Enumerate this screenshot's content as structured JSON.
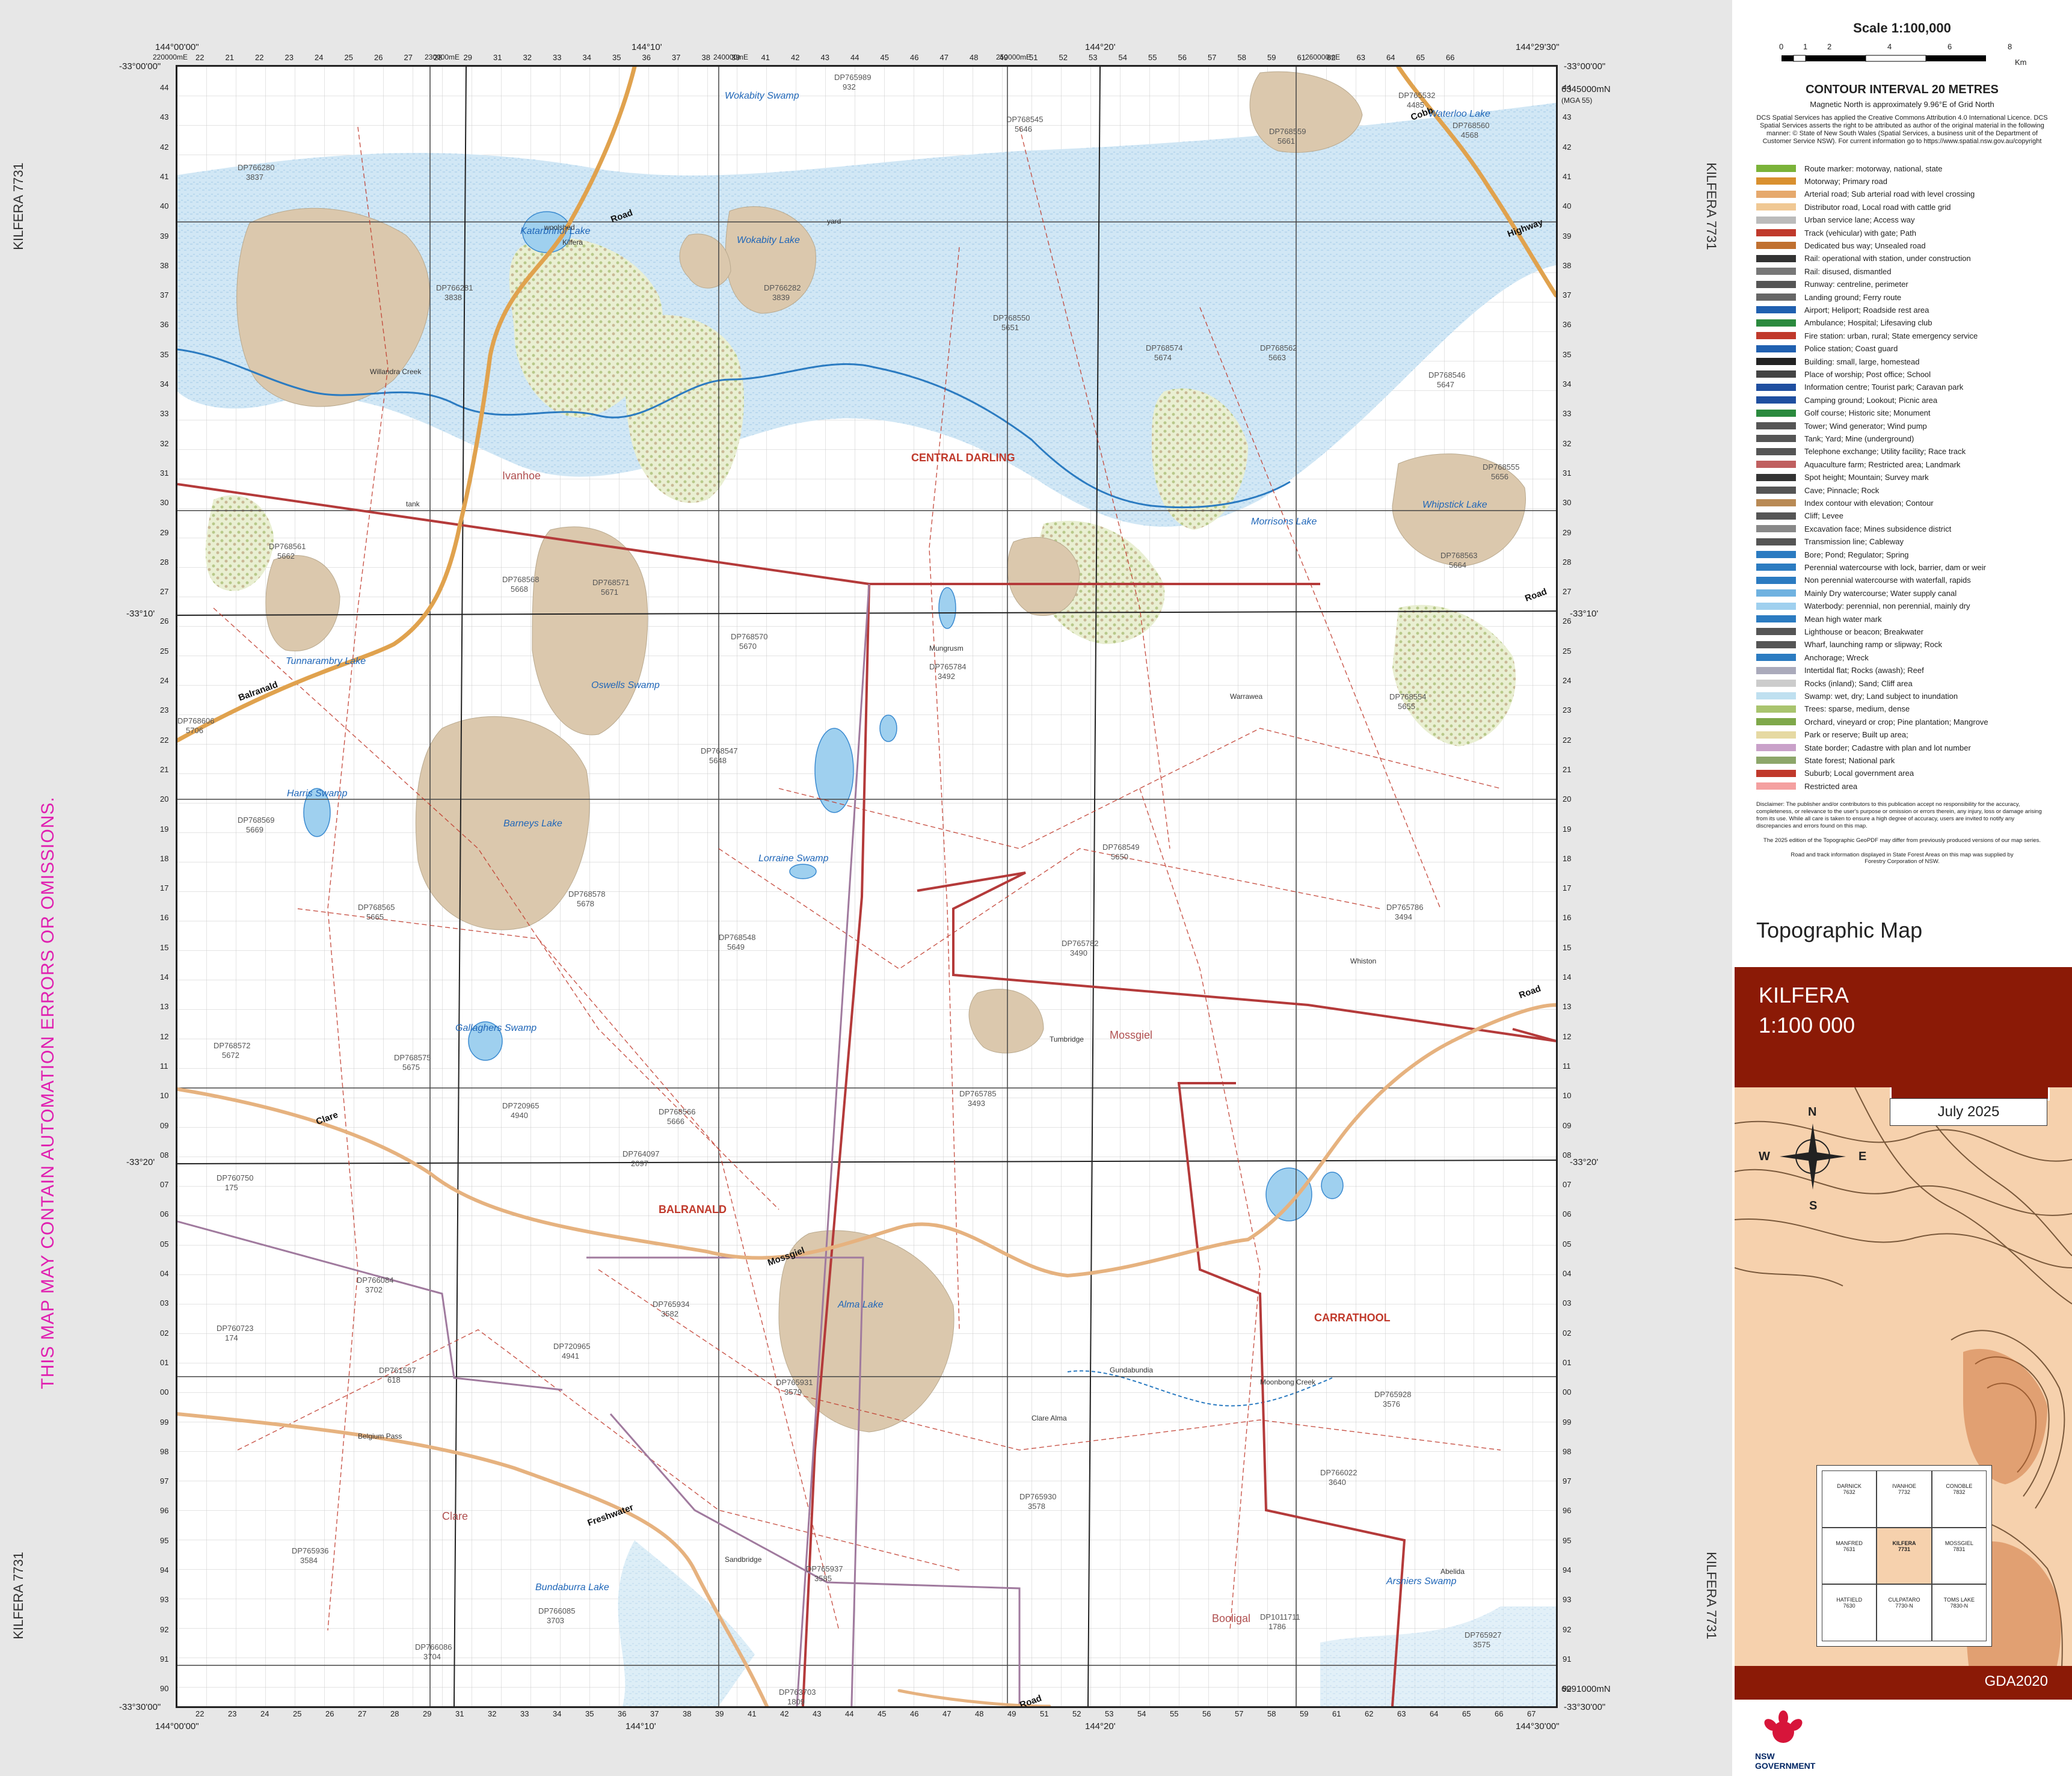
{
  "side_labels": {
    "left_top": "KILFERA 7731",
    "left_bottom": "KILFERA 7731",
    "right_top": "KILFERA 7731",
    "right_bottom": "KILFERA 7731"
  },
  "warning": "THIS MAP MAY CONTAIN AUTOMATION ERRORS OR OMISSIONS.",
  "coords": {
    "top_left_lon": "144°00'00\"",
    "top_left_lat": "-33°00'00\"",
    "top_mid1": "144°10'",
    "top_mid2": "144°20'",
    "top_right_lon": "144°29'30\"",
    "top_right_lat": "-33°00'00\"",
    "left_mid1": "-33°10'",
    "left_mid2": "-33°20'",
    "right_mid1": "-33°10'",
    "right_mid2": "-33°20'",
    "bottom_left_lon": "144°00'00\"",
    "bottom_left_lat": "-33°30'00\"",
    "bottom_mid1": "144°10'",
    "bottom_mid2": "144°20'",
    "bottom_right_lon": "144°30'00\"",
    "bottom_right_lat": "-33°30'00\"",
    "e_top": "220000mE",
    "e_top2": "230000mE",
    "e_top3": "240000mE",
    "e_top4": "250000mE",
    "e_top5": "260000mE",
    "n_top": "6345000mN",
    "n_mga": "(MGA 55)",
    "n_bottom": "6291000mN"
  },
  "grid": {
    "eastings_top": [
      "22",
      "21",
      "22",
      "23",
      "24",
      "25",
      "26",
      "27",
      "28",
      "29",
      "31",
      "32",
      "33",
      "34",
      "35",
      "36",
      "37",
      "38",
      "39",
      "41",
      "42",
      "43",
      "44",
      "45",
      "46",
      "47",
      "48",
      "49",
      "51",
      "52",
      "53",
      "54",
      "55",
      "56",
      "57",
      "58",
      "59",
      "61",
      "62",
      "63",
      "64",
      "65",
      "66"
    ],
    "eastings_bottom": [
      "22",
      "23",
      "24",
      "25",
      "26",
      "27",
      "28",
      "29",
      "31",
      "32",
      "33",
      "34",
      "35",
      "36",
      "37",
      "38",
      "39",
      "41",
      "42",
      "43",
      "44",
      "45",
      "46",
      "47",
      "48",
      "49",
      "51",
      "52",
      "53",
      "54",
      "55",
      "56",
      "57",
      "58",
      "59",
      "61",
      "62",
      "63",
      "64",
      "65",
      "66",
      "67"
    ],
    "northings": [
      "44",
      "43",
      "42",
      "41",
      "40",
      "39",
      "38",
      "37",
      "36",
      "35",
      "34",
      "33",
      "32",
      "31",
      "30",
      "29",
      "28",
      "27",
      "26",
      "25",
      "24",
      "23",
      "22",
      "21",
      "20",
      "19",
      "18",
      "17",
      "16",
      "15",
      "14",
      "13",
      "12",
      "11",
      "10",
      "09",
      "08",
      "07",
      "06",
      "05",
      "04",
      "03",
      "02",
      "01",
      "00",
      "99",
      "98",
      "97",
      "96",
      "95",
      "94",
      "93",
      "92",
      "91",
      "90"
    ]
  },
  "map_labels": {
    "lakes": [
      {
        "name": "Wokabity Swamp"
      },
      {
        "name": "Waterloo Lake"
      },
      {
        "name": "Katarbrinol Lake"
      },
      {
        "name": "Wokabity Lake"
      },
      {
        "name": "Whipstick Lake"
      },
      {
        "name": "Morrisons Lake"
      },
      {
        "name": "Tunnarambry Lake"
      },
      {
        "name": "Oswells Swamp"
      },
      {
        "name": "Harris Swamp"
      },
      {
        "name": "Barneys Lake"
      },
      {
        "name": "Lorraine Swamp"
      },
      {
        "name": "Gallaghers Swamp"
      },
      {
        "name": "Alma Lake"
      },
      {
        "name": "Bundaburra Lake"
      },
      {
        "name": "Arsniers Swamp"
      }
    ],
    "regions": [
      {
        "name": "CENTRAL DARLING"
      },
      {
        "name": "BALRANALD"
      },
      {
        "name": "CARRATHOOL"
      },
      {
        "name": "Mossgiel"
      },
      {
        "name": "Clare"
      },
      {
        "name": "Booligal"
      },
      {
        "name": "Ivanhoe"
      }
    ],
    "roads": [
      {
        "name": "Balranald"
      },
      {
        "name": "Road"
      },
      {
        "name": "Clare"
      },
      {
        "name": "Mossgiel"
      },
      {
        "name": "Cobb"
      },
      {
        "name": "Highway"
      },
      {
        "name": "Freshwater"
      },
      {
        "name": "Road"
      },
      {
        "name": "Road"
      },
      {
        "name": "Road"
      }
    ],
    "lots": [
      {
        "lot": "DP766280",
        "num": "3837"
      },
      {
        "lot": "DP765989",
        "num": "932"
      },
      {
        "lot": "DP768545",
        "num": "5646"
      },
      {
        "lot": "DP768559",
        "num": "5661"
      },
      {
        "lot": "DP766281",
        "num": "3838"
      },
      {
        "lot": "DP766282",
        "num": "3839"
      },
      {
        "lot": "DP768550",
        "num": "5651"
      },
      {
        "lot": "DP768574",
        "num": "5674"
      },
      {
        "lot": "DP768562",
        "num": "5663"
      },
      {
        "lot": "DP768546",
        "num": "5647"
      },
      {
        "lot": "DP768561",
        "num": "5662"
      },
      {
        "lot": "DP768568",
        "num": "5668"
      },
      {
        "lot": "DP768571",
        "num": "5671"
      },
      {
        "lot": "DP768570",
        "num": "5670"
      },
      {
        "lot": "DP765784",
        "num": "3492"
      },
      {
        "lot": "DP768563",
        "num": "5664"
      },
      {
        "lot": "DP768547",
        "num": "5648"
      },
      {
        "lot": "DP768569",
        "num": "5669"
      },
      {
        "lot": "DP768549",
        "num": "5650"
      },
      {
        "lot": "DP768578",
        "num": "5678"
      },
      {
        "lot": "DP768565",
        "num": "5665"
      },
      {
        "lot": "DP768548",
        "num": "5649"
      },
      {
        "lot": "DP765782",
        "num": "3490"
      },
      {
        "lot": "DP765786",
        "num": "3494"
      },
      {
        "lot": "DP768572",
        "num": "5672"
      },
      {
        "lot": "DP768575",
        "num": "5675"
      },
      {
        "lot": "DP720965",
        "num": "4940"
      },
      {
        "lot": "DP765785",
        "num": "3493"
      },
      {
        "lot": "DP768566",
        "num": "5666"
      },
      {
        "lot": "DP760750",
        "num": "175"
      },
      {
        "lot": "DP764097",
        "num": "2097"
      },
      {
        "lot": "DP766084",
        "num": "3702"
      },
      {
        "lot": "DP765934",
        "num": "3582"
      },
      {
        "lot": "DP760723",
        "num": "174"
      },
      {
        "lot": "DP720965",
        "num": "4941"
      },
      {
        "lot": "DP761587",
        "num": "618"
      },
      {
        "lot": "DP765931",
        "num": "3579"
      },
      {
        "lot": "DP765928",
        "num": "3576"
      },
      {
        "lot": "DP766022",
        "num": "3640"
      },
      {
        "lot": "DP765930",
        "num": "3578"
      },
      {
        "lot": "DP765936",
        "num": "3584"
      },
      {
        "lot": "DP765937",
        "num": "3585"
      },
      {
        "lot": "DP766085",
        "num": "3703"
      },
      {
        "lot": "DP766086",
        "num": "3704"
      },
      {
        "lot": "DP1011711",
        "num": "1786"
      },
      {
        "lot": "DP765927",
        "num": "3575"
      },
      {
        "lot": "DP763703",
        "num": "1809"
      },
      {
        "lot": "DP765532",
        "num": "4485"
      },
      {
        "lot": "DP768560",
        "num": "4568"
      },
      {
        "lot": "DP768555",
        "num": "5656"
      },
      {
        "lot": "DP768554",
        "num": "5655"
      },
      {
        "lot": "DP768606",
        "num": "5706"
      }
    ],
    "features": [
      "Kilfera",
      "woolshed",
      "tank",
      "yard",
      "Mungrusm",
      "Tumbridge",
      "Sandbridge",
      "Clare Alma",
      "Belgium Pass",
      "Gundabundia",
      "Moonbong Creek",
      "Willandra Creek",
      "Abelida",
      "Whiston",
      "Warrawea"
    ]
  },
  "panel": {
    "scale_title": "Scale 1:100,000",
    "scale_ticks": [
      "0",
      "1",
      "2",
      "4",
      "6",
      "8"
    ],
    "scale_unit": "Km",
    "contour": "CONTOUR INTERVAL 20 METRES",
    "magnetic": "Magnetic North is approximately 9.96°E of Grid North",
    "licence": "DCS Spatial Services has applied the Creative Commons Attribution 4.0 International Licence. DCS Spatial Services asserts the right to be attributed as author of the original material in the following manner: © State of New South Wales (Spatial Services, a business unit of the Department of Customer Service NSW). For current information go to https://www.spatial.nsw.gov.au/copyright",
    "legend": [
      "Route marker: motorway, national, state",
      "Motorway; Primary road",
      "Arterial road; Sub arterial road with level crossing",
      "Distributor road, Local road with cattle grid",
      "Urban service lane; Access way",
      "Track (vehicular) with gate; Path",
      "Dedicated bus way; Unsealed road",
      "Rail: operational with station, under construction",
      "Rail: disused, dismantled",
      "Runway: centreline, perimeter",
      "Landing ground; Ferry route",
      "Airport; Heliport; Roadside rest area",
      "Ambulance; Hospital; Lifesaving club",
      "Fire station: urban, rural; State emergency service",
      "Police station; Coast guard",
      "Building: small, large, homestead",
      "Place of worship; Post office; School",
      "Information centre; Tourist park; Caravan park",
      "Camping ground; Lookout; Picnic area",
      "Golf course; Historic site; Monument",
      "Tower; Wind generator; Wind pump",
      "Tank; Yard; Mine (underground)",
      "Telephone exchange; Utility facility; Race track",
      "Aquaculture farm; Restricted area; Landmark",
      "Spot height; Mountain; Survey mark",
      "Cave; Pinnacle; Rock",
      "Index contour with elevation; Contour",
      "Cliff; Levee",
      "Excavation face; Mines subsidence district",
      "Transmission line; Cableway",
      "Bore; Pond; Regulator; Spring",
      "Perennial watercourse with lock, barrier, dam or weir",
      "Non perennial watercourse with waterfall, rapids",
      "Mainly Dry watercourse; Water supply canal",
      "Waterbody: perennial, non perennial, mainly dry",
      "Mean high water mark",
      "Lighthouse or beacon; Breakwater",
      "Wharf, launching ramp or slipway; Rock",
      "Anchorage; Wreck",
      "Intertidal flat; Rocks (awash); Reef",
      "Rocks (inland); Sand; Cliff area",
      "Swamp: wet, dry; Land subject to inundation",
      "Trees: sparse, medium, dense",
      "Orchard, vineyard or crop; Pine plantation; Mangrove",
      "Park or reserve; Built up area;",
      "State border; Cadastre with plan and lot number",
      "State forest; National park",
      "Suburb; Local government area",
      "Restricted area"
    ],
    "disclaimer": "Disclaimer: The publisher and/or contributors to this publication accept no responsibility for the accuracy, completeness, or relevance to the user's purpose or omission or errors therein, any injury, loss or damage arising from its use. While all care is taken to ensure a high degree of accuracy, users are invited to notify any discrepancies and errors found on this map.",
    "edition_note": "The 2025 edition of the Topographic GeoPDF may differ from previously produced versions of our map series.",
    "road_note": "Road and track information displayed in State Forest Areas on this map was supplied by Forestry Corporation of NSW.",
    "product": "Topographic Map",
    "map_name": "KILFERA",
    "map_scale": "1:100 000",
    "map_number": "7731",
    "date": "July 2025",
    "datum": "GDA2020",
    "compass": {
      "n": "N",
      "s": "S",
      "e": "E",
      "w": "W"
    },
    "index": [
      {
        "name": "DARNICK",
        "num": "7632"
      },
      {
        "name": "IVANHOE",
        "num": "7732"
      },
      {
        "name": "CONOBLE",
        "num": "7832"
      },
      {
        "name": "MANFRED",
        "num": "7631"
      },
      {
        "name": "KILFERA",
        "num": "7731"
      },
      {
        "name": "MOSSGIEL",
        "num": "7831"
      },
      {
        "name": "HATFIELD",
        "num": "7630"
      },
      {
        "name": "CULPATARO",
        "num": "7730-N"
      },
      {
        "name": "TOMS LAKE",
        "num": "7830-N"
      }
    ],
    "logo": "NSW GOVERNMENT"
  },
  "colors": {
    "water": "#cfe6f4",
    "lake_dry": "#dbc8ad",
    "road_major": "#e7a96d",
    "boundary": "#b43a3a",
    "grid": "#555",
    "accent": "#8b1a06"
  }
}
